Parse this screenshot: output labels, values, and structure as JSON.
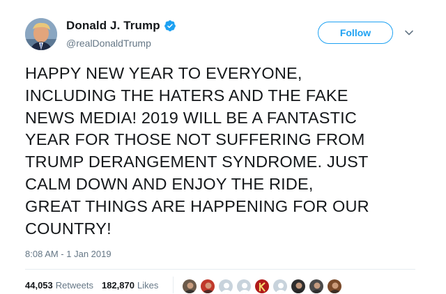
{
  "author": {
    "display_name": "Donald J. Trump",
    "handle": "@realDonaldTrump",
    "verified": true,
    "verified_color": "#1da1f2"
  },
  "follow_button": {
    "label": "Follow"
  },
  "tweet": {
    "lines": [
      "HAPPY NEW YEAR TO EVERYONE,",
      "INCLUDING THE HATERS AND THE FAKE",
      "NEWS MEDIA! 2019 WILL BE A FANTASTIC",
      "YEAR FOR THOSE NOT SUFFERING FROM",
      "TRUMP DERANGEMENT SYNDROME. JUST",
      "CALM DOWN AND ENJOY THE RIDE,",
      "GREAT THINGS ARE HAPPENING FOR OUR",
      "COUNTRY!"
    ],
    "timestamp": "8:08 AM - 1 Jan 2019"
  },
  "stats": {
    "retweets_count": "44,053",
    "retweets_label": "Retweets",
    "likes_count": "182,870",
    "likes_label": "Likes"
  },
  "likers": [
    {
      "icon": "user-avatar-icon",
      "color": "#6b5a4a"
    },
    {
      "icon": "user-avatar-icon",
      "color": "#c0392b"
    },
    {
      "icon": "default-egg-icon",
      "color": "#c8d3dc"
    },
    {
      "icon": "default-egg-icon",
      "color": "#c8d3dc"
    },
    {
      "icon": "letter-k-icon",
      "color": "#b01a1a"
    },
    {
      "icon": "default-egg-icon",
      "color": "#c8d3dc"
    },
    {
      "icon": "user-avatar-icon",
      "color": "#2e2e2e"
    },
    {
      "icon": "user-avatar-icon",
      "color": "#4a4a4a"
    },
    {
      "icon": "user-avatar-icon",
      "color": "#7a4a2a"
    }
  ],
  "colors": {
    "text": "#14171a",
    "secondary": "#657786",
    "accent": "#1da1f2",
    "divider": "#e6ecf0"
  }
}
